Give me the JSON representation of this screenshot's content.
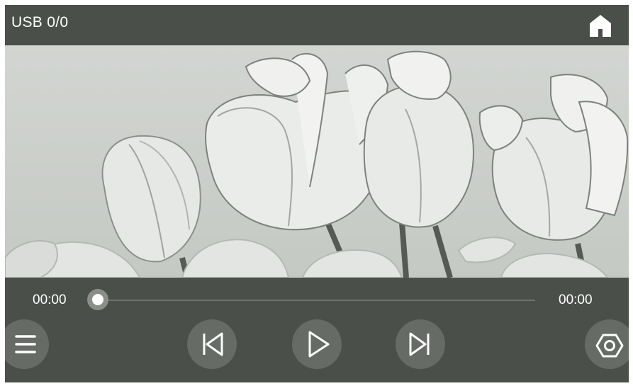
{
  "top_bar": {
    "source_label": "USB 0/0",
    "home_icon": "home-icon"
  },
  "playback": {
    "current_time": "00:00",
    "total_time": "00:00",
    "progress": 0,
    "state": "paused"
  },
  "controls": {
    "menu_icon": "hamburger-menu-icon",
    "previous_icon": "skip-previous-icon",
    "play_icon": "play-icon",
    "next_icon": "skip-next-icon",
    "settings_icon": "hexagon-settings-icon"
  },
  "colors": {
    "bar_background": "#4a4f49",
    "button_background": "#666b65",
    "icon_color": "#ffffff"
  }
}
